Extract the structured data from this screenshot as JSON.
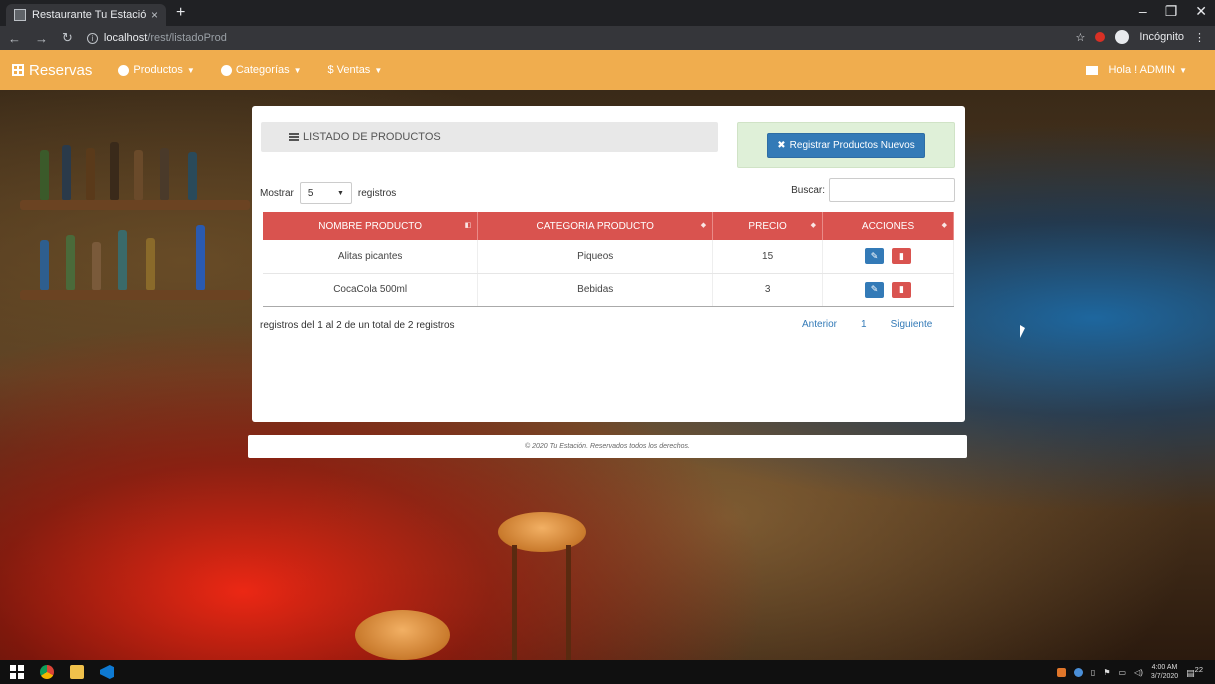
{
  "browser": {
    "tab_title": "Restaurante Tu Estación",
    "tab_close": "×",
    "new_tab": "+",
    "url_host": "localhost",
    "url_path": "/rest/listadoProd",
    "profile_label": "Incógnito"
  },
  "navbar": {
    "brand": "Reservas",
    "items": [
      {
        "label": "Productos"
      },
      {
        "label": "Categorías"
      },
      {
        "label": "Ventas"
      }
    ],
    "dollar": "$",
    "user": "Hola ! ADMIN"
  },
  "panel": {
    "heading": "LISTADO DE PRODUCTOS",
    "register_button": "Registrar Productos Nuevos",
    "show_label": "Mostrar",
    "page_size": "5",
    "records_label": "registros",
    "search_label": "Buscar:",
    "columns": [
      "NOMBRE PRODUCTO",
      "CATEGORIA PRODUCTO",
      "PRECIO",
      "ACCIONES"
    ],
    "rows": [
      {
        "name": "Alitas picantes",
        "category": "Piqueos",
        "price": "15"
      },
      {
        "name": "CocaCola 500ml",
        "category": "Bebidas",
        "price": "3"
      }
    ],
    "info": "registros del 1 al 2 de un total de 2 registros",
    "pager": {
      "prev": "Anterior",
      "page": "1",
      "next": "Siguiente"
    }
  },
  "footer": "© 2020 Tu Estación. Reservados todos los derechos.",
  "taskbar": {
    "time": "4:00 AM",
    "date": "3/7/2020",
    "notif_count": "22"
  },
  "colors": {
    "navbar": "#f0ad4e",
    "table_header": "#d9534f",
    "primary": "#337ab7",
    "register_bg": "#dff0d8"
  }
}
